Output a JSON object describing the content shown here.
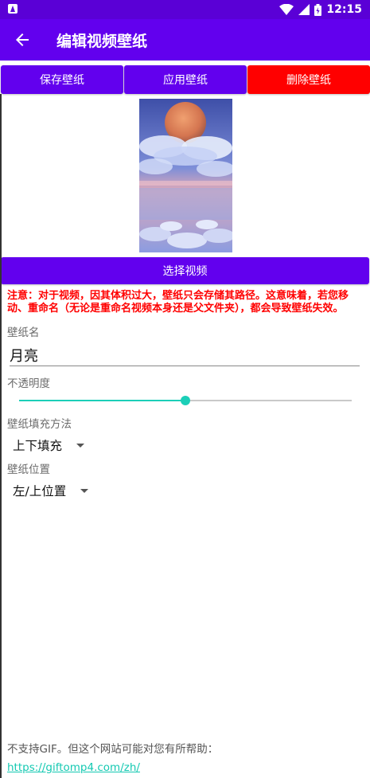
{
  "status_bar": {
    "time": "12:15"
  },
  "toolbar": {
    "title": "编辑视频壁纸"
  },
  "actions": {
    "save": "保存壁纸",
    "apply": "应用壁纸",
    "delete": "删除壁纸"
  },
  "select_video": "选择视频",
  "warning": "注意：对于视频，因其体积过大，壁纸只会存储其路径。这意味着，若您移动、重命名（无论是重命名视频本身还是父文件夹），都会导致壁纸失效。",
  "name_field": {
    "label": "壁纸名",
    "value": "月亮"
  },
  "opacity": {
    "label": "不透明度",
    "value": 0.5
  },
  "fill_method": {
    "label": "壁纸填充方法",
    "selected": "上下填充"
  },
  "position": {
    "label": "壁纸位置",
    "selected": "左/上位置"
  },
  "footer": {
    "note": "不支持GIF。但这个网站可能对您有所帮助：",
    "link": "https://giftomp4.com/zh/"
  },
  "colors": {
    "primary": "#6200ee",
    "danger": "#ff0000",
    "accent": "#1ccfb8"
  }
}
